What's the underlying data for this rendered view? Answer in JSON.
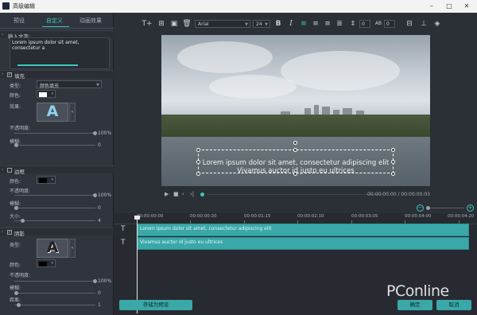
{
  "window": {
    "title": "高级编辑"
  },
  "tabs": [
    "预设",
    "自定义",
    "动画效果"
  ],
  "sections": {
    "input_text": {
      "label": "输入文字:",
      "value": "Lorem ipsum dolor sit amet, consectetur a"
    },
    "fill": {
      "label": "填充",
      "checked": true,
      "type_label": "类型:",
      "type_value": "颜色填充",
      "color_label": "颜色:",
      "color": "#ffffff",
      "effect_label": "效果:",
      "effect_glyph": "A",
      "opacity_label": "不透明度:",
      "opacity_value": "100%",
      "opacity_level": 1,
      "blur_label": "模糊:",
      "blur_value": "0"
    },
    "border": {
      "label": "边框",
      "checked": false,
      "color_label": "颜色:",
      "color": "#000000",
      "opacity_label": "不透明度:",
      "opacity_value": "100%",
      "blur_label": "模糊:",
      "blur_value": "0",
      "size_label": "大小:",
      "size_value": "4"
    },
    "shadow": {
      "label": "阴影",
      "checked": true,
      "type_label": "类型:",
      "effect_glyph": "A",
      "color_label": "颜色:",
      "color": "#000000",
      "opacity_label": "不透明度:",
      "opacity_value": "100%",
      "blur_label": "模糊:",
      "blur_value": "0",
      "distance_label": "距离:",
      "distance_value": "1"
    }
  },
  "toolbar": {
    "font": "Arial",
    "size": "24",
    "bold": "B",
    "italic": "I",
    "spacing_value": "0",
    "line_spacing_value": "0"
  },
  "preview": {
    "overlay_line1": "Lorem ipsum dolor sit amet, consectetur adipiscing elit",
    "overlay_line2": "Vivamus auctor id justo eu ultrices"
  },
  "playback": {
    "time": "00:00:00:00 / 00:00:00:03"
  },
  "timeline": {
    "ticks": [
      "00:00:00:00",
      "00:00:00:20",
      "00:00:01:15",
      "00:00:02:10",
      "00:00:03:05",
      "00:00:04:00",
      "00:00:04:20"
    ],
    "tracks": [
      {
        "icon": "T",
        "clip": "Lorem ipsum dolor sit amet, consectetur adipiscing elit"
      },
      {
        "icon": "T",
        "clip": "Vivamus auctor id justo eu ultrices"
      }
    ]
  },
  "buttons": {
    "save_preset": "存储为预设",
    "ok": "确定",
    "cancel": "取消"
  },
  "watermark": "PConline",
  "colors": {
    "accent": "#3bc9c0",
    "clip": "#3aa8a8"
  }
}
